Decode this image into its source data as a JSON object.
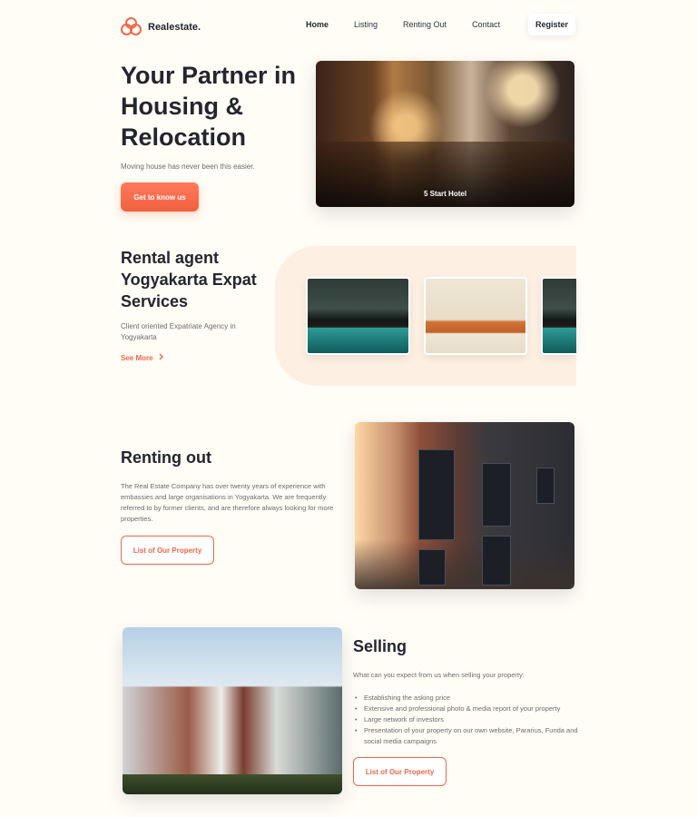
{
  "nav": {
    "logo_text": "Realestate.",
    "items": [
      {
        "label": "Home",
        "active": true
      },
      {
        "label": "Listing",
        "active": false
      },
      {
        "label": "Renting Out",
        "active": false
      },
      {
        "label": "Contact",
        "active": false
      }
    ],
    "register_label": "Register"
  },
  "hero": {
    "title": "Your Partner in Housing & Relocation",
    "subtitle": "Moving house has never been this easier.",
    "cta_label": "Get to know us",
    "image_caption": "5 Start Hotel"
  },
  "agent": {
    "title": "Rental agent Yogyakarta Expat Services",
    "subtitle": "Client oriented Expatriate Agency in Yogyakarta",
    "see_more_label": "See More",
    "thumbnails": [
      "pool-image",
      "living-room-image",
      "pool-image"
    ]
  },
  "renting": {
    "title": "Renting out",
    "text": "The Real Estate Company has over twenty years of experience with embassies and large organisations in Yogyakarta. We are frequently referred to by former clients, and are therefore always looking for more properties.",
    "button_label": "List of Our Property"
  },
  "selling": {
    "title": "Selling",
    "subtitle": "What can you expect from us when selling your property:",
    "items": [
      "Establishing the asking price",
      "Extensive and professional photo & media report of your property",
      "Large network of investors",
      "Presentation of your property on our own website, Pararius, Funda and social media campaigns"
    ],
    "button_label": "List of Our Property"
  },
  "colors": {
    "accent": "#f0674a",
    "background": "#fffdf6",
    "soft_panel": "#fdf0e2",
    "heading": "#23262f"
  }
}
